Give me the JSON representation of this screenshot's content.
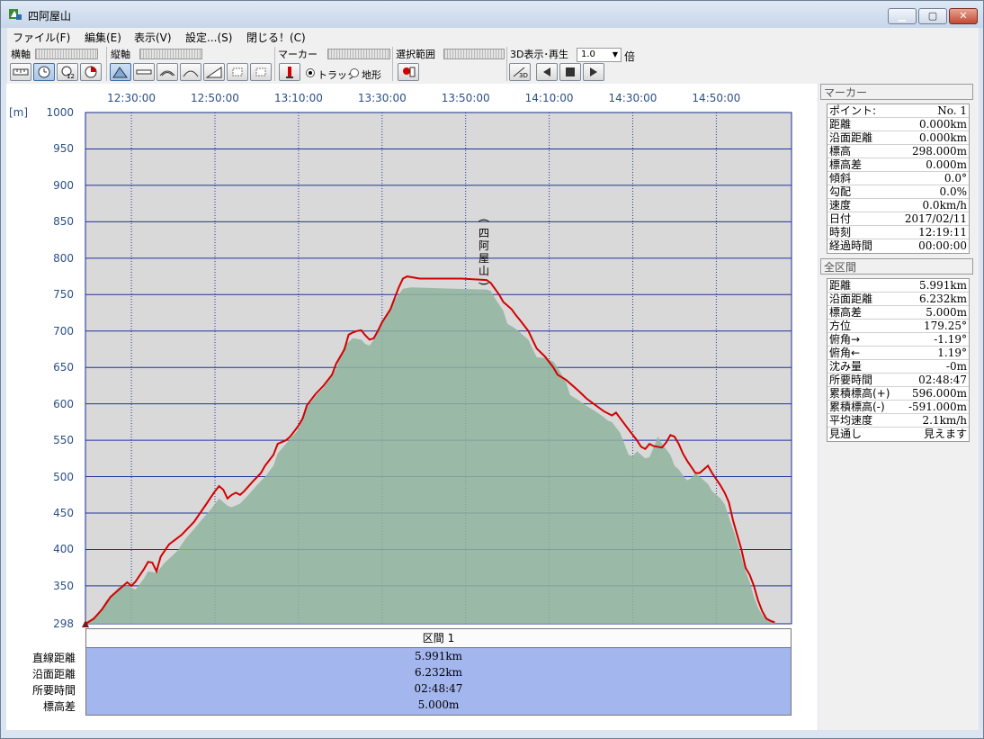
{
  "window": {
    "title": "四阿屋山"
  },
  "menu": [
    "ファイル(F)",
    "編集(E)",
    "表示(V)",
    "設定...(S)",
    "閉じる！(C)"
  ],
  "toolbar": {
    "yokojiku": "横軸",
    "tatejiku": "縦軸",
    "marker": "マーカー",
    "selection": "選択範囲",
    "threed": "3D表示･再生",
    "speed_value": "1.0",
    "speed_unit": "倍",
    "radio_track": "トラック",
    "radio_terrain": "地形"
  },
  "chart_data": {
    "type": "area",
    "x_tick_labels": [
      "12:30:00",
      "12:50:00",
      "13:10:00",
      "13:30:00",
      "13:50:00",
      "14:10:00",
      "14:30:00",
      "14:50:00"
    ],
    "y_unit": "[m]",
    "y_tick_labels": [
      "1000",
      "950",
      "900",
      "850",
      "800",
      "750",
      "700",
      "650",
      "600",
      "550",
      "500",
      "450",
      "400",
      "350",
      "298"
    ],
    "ylim": [
      298,
      1000
    ],
    "x_minutes_range": [
      0,
      169
    ],
    "peak_label": "(四阿屋山)",
    "colors": {
      "track": "#d40000",
      "terrain": "#8fb39d",
      "grid": "#2133a0",
      "plot_bg": "#d9d9d9"
    },
    "series": [
      {
        "name": "トラック",
        "values": [
          [
            0,
            298
          ],
          [
            2,
            305
          ],
          [
            4,
            318
          ],
          [
            6,
            335
          ],
          [
            8,
            345
          ],
          [
            10,
            355
          ],
          [
            11,
            350
          ],
          [
            12,
            356
          ],
          [
            14,
            373
          ],
          [
            15,
            383
          ],
          [
            16,
            382
          ],
          [
            17,
            370
          ],
          [
            18,
            390
          ],
          [
            20,
            407
          ],
          [
            23,
            420
          ],
          [
            26,
            438
          ],
          [
            29,
            463
          ],
          [
            31,
            480
          ],
          [
            32,
            487
          ],
          [
            33,
            482
          ],
          [
            34,
            470
          ],
          [
            35,
            475
          ],
          [
            36,
            478
          ],
          [
            37,
            475
          ],
          [
            38,
            480
          ],
          [
            40,
            493
          ],
          [
            42,
            505
          ],
          [
            43,
            515
          ],
          [
            45,
            530
          ],
          [
            46,
            545
          ],
          [
            48,
            550
          ],
          [
            49,
            555
          ],
          [
            51,
            570
          ],
          [
            52,
            580
          ],
          [
            53,
            598
          ],
          [
            55,
            613
          ],
          [
            57,
            625
          ],
          [
            59,
            640
          ],
          [
            60,
            655
          ],
          [
            62,
            675
          ],
          [
            63,
            695
          ],
          [
            64,
            698
          ],
          [
            65,
            700
          ],
          [
            66,
            701
          ],
          [
            67,
            694
          ],
          [
            68,
            688
          ],
          [
            69,
            690
          ],
          [
            70,
            700
          ],
          [
            71,
            712
          ],
          [
            73,
            730
          ],
          [
            74,
            745
          ],
          [
            75,
            760
          ],
          [
            76,
            772
          ],
          [
            77,
            775
          ],
          [
            80,
            772
          ],
          [
            90,
            772
          ],
          [
            96,
            770
          ],
          [
            97,
            766
          ],
          [
            99,
            750
          ],
          [
            100,
            740
          ],
          [
            102,
            730
          ],
          [
            103,
            722
          ],
          [
            104,
            715
          ],
          [
            106,
            700
          ],
          [
            107,
            688
          ],
          [
            108,
            676
          ],
          [
            110,
            665
          ],
          [
            112,
            650
          ],
          [
            113,
            640
          ],
          [
            115,
            633
          ],
          [
            118,
            618
          ],
          [
            120,
            607
          ],
          [
            124,
            590
          ],
          [
            126,
            584
          ],
          [
            127,
            588
          ],
          [
            128,
            580
          ],
          [
            130,
            565
          ],
          [
            132,
            550
          ],
          [
            133,
            541
          ],
          [
            134,
            538
          ],
          [
            135,
            545
          ],
          [
            136,
            542
          ],
          [
            138,
            540
          ],
          [
            139,
            547
          ],
          [
            140,
            557
          ],
          [
            141,
            555
          ],
          [
            142,
            545
          ],
          [
            143,
            532
          ],
          [
            144,
            522
          ],
          [
            146,
            505
          ],
          [
            147,
            505
          ],
          [
            148,
            510
          ],
          [
            149,
            515
          ],
          [
            150,
            505
          ],
          [
            152,
            488
          ],
          [
            153,
            478
          ],
          [
            154,
            465
          ],
          [
            155,
            440
          ],
          [
            156,
            420
          ],
          [
            157,
            400
          ],
          [
            158,
            375
          ],
          [
            159,
            365
          ],
          [
            160,
            350
          ],
          [
            161,
            330
          ],
          [
            162,
            315
          ],
          [
            163,
            305
          ],
          [
            164,
            302
          ],
          [
            165,
            300
          ]
        ]
      },
      {
        "name": "地形",
        "values": [
          [
            0,
            298
          ],
          [
            3,
            312
          ],
          [
            5,
            330
          ],
          [
            8,
            348
          ],
          [
            10,
            350
          ],
          [
            12,
            345
          ],
          [
            14,
            360
          ],
          [
            15,
            370
          ],
          [
            17,
            368
          ],
          [
            19,
            382
          ],
          [
            22,
            398
          ],
          [
            24,
            415
          ],
          [
            26,
            428
          ],
          [
            28,
            442
          ],
          [
            30,
            455
          ],
          [
            32,
            470
          ],
          [
            34,
            460
          ],
          [
            35,
            458
          ],
          [
            37,
            463
          ],
          [
            39,
            475
          ],
          [
            41,
            488
          ],
          [
            43,
            500
          ],
          [
            45,
            515
          ],
          [
            46,
            532
          ],
          [
            48,
            545
          ],
          [
            49,
            552
          ],
          [
            51,
            565
          ],
          [
            52,
            578
          ],
          [
            53,
            595
          ],
          [
            55,
            610
          ],
          [
            57,
            622
          ],
          [
            58,
            630
          ],
          [
            60,
            648
          ],
          [
            61,
            665
          ],
          [
            62,
            680
          ],
          [
            64,
            690
          ],
          [
            66,
            688
          ],
          [
            67,
            682
          ],
          [
            68,
            680
          ],
          [
            69,
            688
          ],
          [
            70,
            702
          ],
          [
            72,
            720
          ],
          [
            74,
            742
          ],
          [
            76,
            758
          ],
          [
            78,
            760
          ],
          [
            88,
            758
          ],
          [
            96,
            757
          ],
          [
            97,
            755
          ],
          [
            98,
            745
          ],
          [
            100,
            728
          ],
          [
            101,
            710
          ],
          [
            103,
            703
          ],
          [
            104,
            698
          ],
          [
            106,
            688
          ],
          [
            107,
            676
          ],
          [
            108,
            664
          ],
          [
            110,
            663
          ],
          [
            112,
            658
          ],
          [
            113,
            650
          ],
          [
            115,
            630
          ],
          [
            116,
            612
          ],
          [
            118,
            605
          ],
          [
            120,
            597
          ],
          [
            122,
            590
          ],
          [
            124,
            582
          ],
          [
            125,
            577
          ],
          [
            126,
            575
          ],
          [
            128,
            560
          ],
          [
            129,
            545
          ],
          [
            130,
            530
          ],
          [
            131,
            528
          ],
          [
            132,
            535
          ],
          [
            134,
            525
          ],
          [
            135,
            527
          ],
          [
            136,
            540
          ],
          [
            137,
            555
          ],
          [
            138,
            545
          ],
          [
            140,
            530
          ],
          [
            141,
            515
          ],
          [
            142,
            510
          ],
          [
            143,
            502
          ],
          [
            144,
            495
          ],
          [
            145,
            498
          ],
          [
            146,
            505
          ],
          [
            147,
            500
          ],
          [
            149,
            490
          ],
          [
            150,
            480
          ],
          [
            152,
            470
          ],
          [
            153,
            462
          ],
          [
            154,
            445
          ],
          [
            155,
            428
          ],
          [
            156,
            410
          ],
          [
            157,
            390
          ],
          [
            158,
            370
          ],
          [
            159,
            355
          ],
          [
            160,
            335
          ],
          [
            161,
            320
          ],
          [
            162,
            310
          ],
          [
            163,
            305
          ],
          [
            164,
            302
          ],
          [
            165,
            300
          ]
        ]
      }
    ]
  },
  "section": {
    "title": "区間 1",
    "labels": [
      "直線距離",
      "沿面距離",
      "所要時間",
      "標高差"
    ],
    "values": [
      "5.991km",
      "6.232km",
      "02:48:47",
      "5.000m"
    ]
  },
  "marker_panel": {
    "title": "マーカー",
    "rows": [
      {
        "k": "ポイント:",
        "v": "No. 1"
      },
      {
        "k": "距離",
        "v": "0.000km"
      },
      {
        "k": "沿面距離",
        "v": "0.000km"
      },
      {
        "k": "標高",
        "v": "298.000m"
      },
      {
        "k": "標高差",
        "v": "0.000m"
      },
      {
        "k": "傾斜",
        "v": "0.0°"
      },
      {
        "k": "勾配",
        "v": "0.0%"
      },
      {
        "k": "速度",
        "v": "0.0km/h"
      },
      {
        "k": "日付",
        "v": "2017/02/11"
      },
      {
        "k": "時刻",
        "v": "12:19:11"
      },
      {
        "k": "経過時間",
        "v": "00:00:00"
      }
    ]
  },
  "total_panel": {
    "title": "全区間",
    "rows": [
      {
        "k": "距離",
        "v": "5.991km"
      },
      {
        "k": "沿面距離",
        "v": "6.232km"
      },
      {
        "k": "標高差",
        "v": "5.000m"
      },
      {
        "k": "方位",
        "v": "179.25°"
      },
      {
        "k": "俯角→",
        "v": "-1.19°"
      },
      {
        "k": "俯角←",
        "v": "1.19°"
      },
      {
        "k": "沈み量",
        "v": "-0m"
      },
      {
        "k": "所要時間",
        "v": "02:48:47"
      },
      {
        "k": "累積標高(+)",
        "v": "596.000m"
      },
      {
        "k": "累積標高(-)",
        "v": "-591.000m"
      },
      {
        "k": "平均速度",
        "v": "2.1km/h"
      },
      {
        "k": "見通し",
        "v": "見えます"
      }
    ]
  }
}
